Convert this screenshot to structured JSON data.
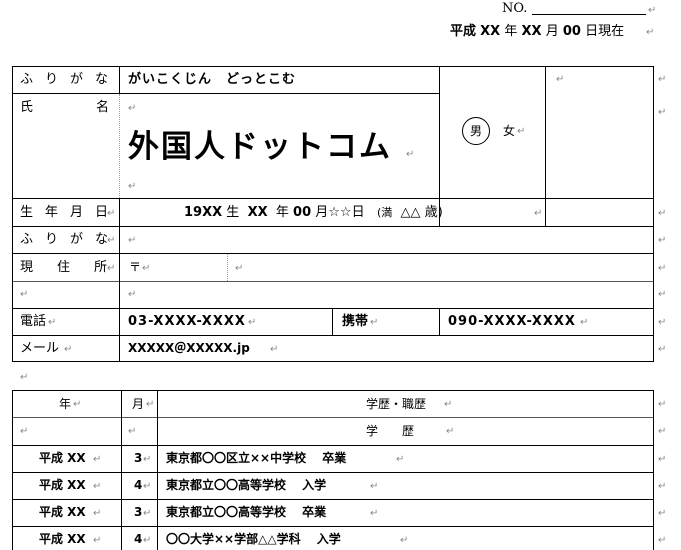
{
  "header": {
    "no_label": "NO.",
    "date_line": [
      "平成",
      "XX",
      "年",
      "XX",
      "月",
      "00",
      "日現在"
    ]
  },
  "form": {
    "furigana_label": "ふりがな",
    "furigana_value": "がいこくじん　どっとこむ",
    "name_label": "氏名",
    "name_value": "外国人ドットコム",
    "gender_male": "男",
    "gender_female": "女",
    "birth_label": "生年月日",
    "birth_value": [
      "19XX",
      "生",
      "XX",
      "年",
      "00",
      "月☆☆日",
      "(満",
      "△△",
      "歳)"
    ],
    "furigana2_label": "ふりがな",
    "address_label": "現住所",
    "postal_mark": "〒",
    "phone_label": "電話",
    "phone_value": "03-XXXX-XXXX",
    "mobile_label": "携帯",
    "mobile_value": "090-XXXX-XXXX",
    "mail_label": "メール",
    "mail_value": "XXXXX＠XXXXX.jp"
  },
  "history": {
    "col_year": "年",
    "col_month": "月",
    "col_detail": "学歴・職歴",
    "sub_detail": "学　　歴",
    "rows": [
      {
        "year": "平成 XX",
        "month": "3",
        "detail": "東京都〇〇区立××中学校　 卒業"
      },
      {
        "year": "平成 XX",
        "month": "4",
        "detail": "東京都立〇〇高等学校　 入学"
      },
      {
        "year": "平成 XX",
        "month": "3",
        "detail": "東京都立〇〇高等学校　 卒業"
      },
      {
        "year": "平成 XX",
        "month": "4",
        "detail": "〇〇大学××学部△△学科　 入学"
      }
    ]
  },
  "paragraph_mark": "↵"
}
